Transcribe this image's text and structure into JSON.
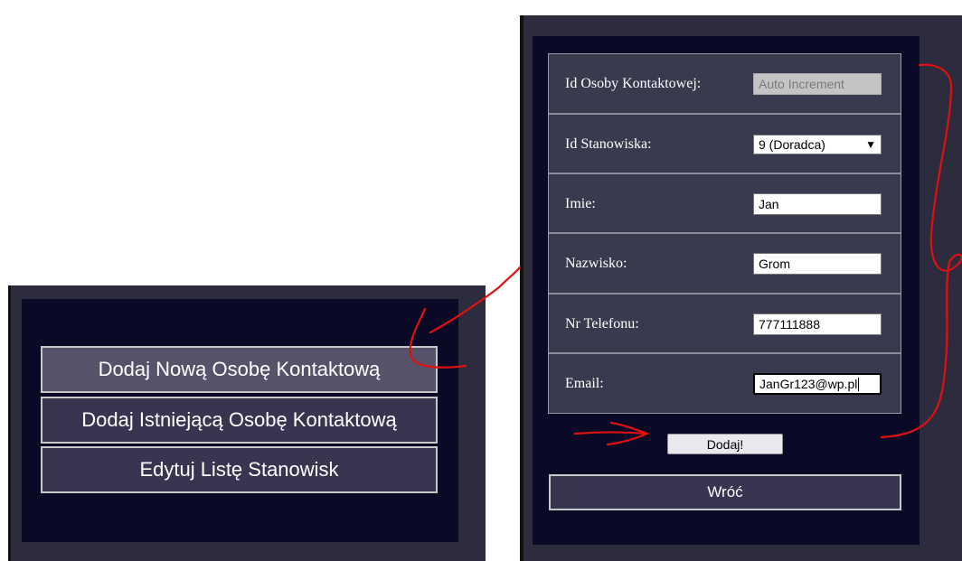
{
  "left_menu": {
    "items": [
      {
        "label": "Dodaj Nową Osobę Kontaktową"
      },
      {
        "label": "Dodaj Istniejącą Osobę Kontaktową"
      },
      {
        "label": "Edytuj Listę Stanowisk"
      }
    ]
  },
  "form": {
    "rows": [
      {
        "label": "Id Osoby Kontaktowej:",
        "value": "Auto Increment"
      },
      {
        "label": "Id Stanowiska:",
        "value": "9 (Doradca)"
      },
      {
        "label": "Imie:",
        "value": "Jan"
      },
      {
        "label": "Nazwisko:",
        "value": "Grom"
      },
      {
        "label": "Nr Telefonu:",
        "value": "777111888"
      },
      {
        "label": "Email:",
        "value": "JanGr123@wp.pl"
      }
    ],
    "submit_label": "Dodaj!",
    "back_label": "Wróć"
  },
  "colors": {
    "panel_outer": "#2c2c3e",
    "panel_inner": "#0b0a26",
    "button_bg": "#383550",
    "annotation": "#e01010"
  }
}
